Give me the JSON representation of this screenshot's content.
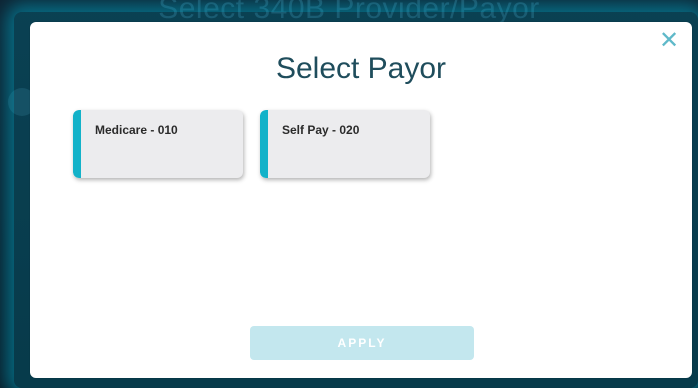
{
  "background": {
    "title": "Select 340B Provider/Payor"
  },
  "modal": {
    "title": "Select Payor",
    "close_icon": "close-icon",
    "payors": [
      {
        "label": "Medicare - 010"
      },
      {
        "label": "Self Pay - 020"
      }
    ],
    "apply_label": "APPLY"
  },
  "colors": {
    "accent": "#13b2c9",
    "title_text": "#1f4d5c",
    "apply_disabled_bg": "#c3e7ee",
    "card_bg": "#ececee"
  }
}
